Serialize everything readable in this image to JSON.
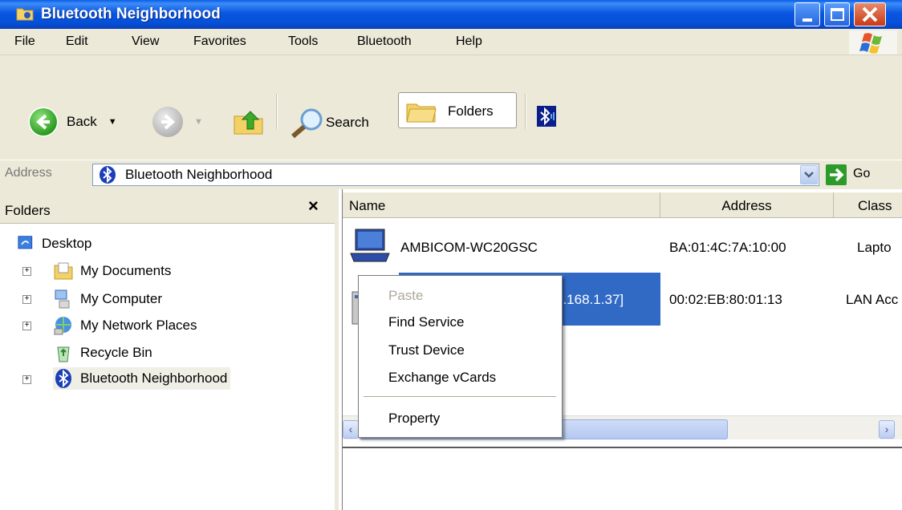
{
  "window": {
    "title": "Bluetooth Neighborhood"
  },
  "menubar": {
    "items": [
      "File",
      "Edit",
      "View",
      "Favorites",
      "Tools",
      "Bluetooth",
      "Help"
    ]
  },
  "toolbar": {
    "back_label": "Back",
    "search_label": "Search",
    "folders_label": "Folders"
  },
  "addressbar": {
    "label": "Address",
    "value": "Bluetooth Neighborhood",
    "go_label": "Go"
  },
  "folders_pane": {
    "title": "Folders",
    "close_glyph": "×",
    "tree": [
      {
        "label": "Desktop"
      },
      {
        "label": "My Documents"
      },
      {
        "label": "My Computer"
      },
      {
        "label": "My Network Places"
      },
      {
        "label": "Recycle Bin"
      },
      {
        "label": "Bluetooth Neighborhood"
      }
    ]
  },
  "list": {
    "columns": [
      "Name",
      "Address",
      "Class"
    ],
    "rows": [
      {
        "name": "AMBICOM-WC20GSC",
        "address": "BA:01:4C:7A:10:00",
        "class": "Lapto"
      },
      {
        "name": "2.168.1.37]",
        "address": "00:02:EB:80:01:13",
        "class": "LAN Acc"
      }
    ]
  },
  "context_menu": {
    "items": [
      "Paste",
      "Find Service",
      "Trust Device",
      "Exchange vCards",
      "Property"
    ]
  },
  "colors": {
    "titlebar": "#0a56e0",
    "chrome": "#ece9d8",
    "selection": "#316ac5"
  }
}
